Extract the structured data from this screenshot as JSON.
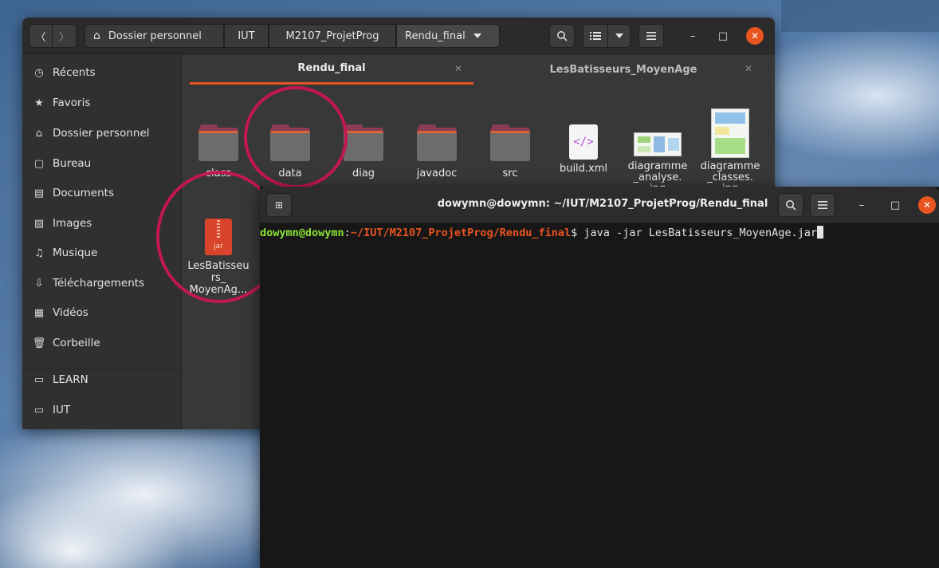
{
  "files_window": {
    "breadcrumbs": [
      "Dossier personnel",
      "IUT",
      "M2107_ProjetProg",
      "Rendu_final"
    ],
    "tabs": [
      {
        "label": "Rendu_final",
        "active": true
      },
      {
        "label": "LesBatisseurs_MoyenAge",
        "active": false
      }
    ],
    "sidebar": {
      "items": [
        {
          "label": "Récents",
          "icon": "clock-icon"
        },
        {
          "label": "Favoris",
          "icon": "star-icon"
        },
        {
          "label": "Dossier personnel",
          "icon": "home-icon"
        },
        {
          "label": "Bureau",
          "icon": "desktop-icon"
        },
        {
          "label": "Documents",
          "icon": "document-icon"
        },
        {
          "label": "Images",
          "icon": "image-icon"
        },
        {
          "label": "Musique",
          "icon": "music-icon"
        },
        {
          "label": "Téléchargements",
          "icon": "download-icon"
        },
        {
          "label": "Vidéos",
          "icon": "video-icon"
        },
        {
          "label": "Corbeille",
          "icon": "trash-icon"
        }
      ],
      "bookmarks": [
        {
          "label": "LEARN",
          "icon": "folder-icon"
        },
        {
          "label": "IUT",
          "icon": "folder-icon"
        }
      ]
    },
    "files": [
      {
        "name": "class",
        "type": "folder"
      },
      {
        "name": "data",
        "type": "folder"
      },
      {
        "name": "diag",
        "type": "folder"
      },
      {
        "name": "javadoc",
        "type": "folder"
      },
      {
        "name": "src",
        "type": "folder"
      },
      {
        "name": "build.xml",
        "type": "xml"
      },
      {
        "name": "diagramme_analyse.jpg",
        "display": "diagramme\n_analyse.\njpg",
        "type": "image"
      },
      {
        "name": "diagramme_classes.jpg",
        "display": "diagramme\n_classes.\njpg",
        "type": "image"
      },
      {
        "name": "LesBatisseurs_MoyenAge.jar",
        "display": "LesBatisseu\nrs_\nMoyenAg...",
        "type": "jar",
        "icon_label": "jar"
      }
    ],
    "colors": {
      "accent": "#e95420",
      "highlight_ring": "#c2184d"
    }
  },
  "terminal": {
    "title": "dowymn@dowymn: ~/IUT/M2107_ProjetProg/Rendu_final",
    "prompt_user": "dowymn@dowymn",
    "prompt_sep": ":",
    "prompt_path": "~/IUT/M2107_ProjetProg/Rendu_final",
    "prompt_symbol": "$ ",
    "command": "java -jar LesBatisseurs_MoyenAge.jar"
  }
}
